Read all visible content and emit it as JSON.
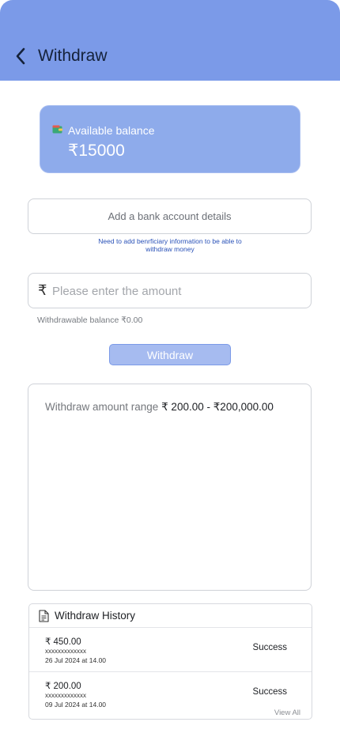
{
  "header": {
    "title": "Withdraw",
    "back_icon": "chevron-left-icon"
  },
  "balance": {
    "label": "Available balance",
    "value": "₹15000",
    "icon": "wallet-icon"
  },
  "bank": {
    "button_label": "Add a bank account details",
    "note": "Need to add benrficiary information to be able to withdraw money"
  },
  "amount": {
    "currency_symbol": "₹",
    "placeholder": "Please enter the amount",
    "value": "",
    "withdrawable_text": "Withdrawable balance ₹0.00"
  },
  "withdraw_button": {
    "label": "Withdraw"
  },
  "range": {
    "label": "Withdraw amount range",
    "value": "₹ 200.00 - ₹200,000.00"
  },
  "history": {
    "title": "Withdraw History",
    "icon": "document-icon",
    "items": [
      {
        "amount": "₹ 450.00",
        "account": "xxxxxxxxxxxxx",
        "date": "26 Jul 2024 at 14.00",
        "status": "Success"
      },
      {
        "amount": "₹ 200.00",
        "account": "xxxxxxxxxxxxx",
        "date": "09 Jul 2024 at 14.00",
        "status": "Success"
      }
    ],
    "view_all": "View All"
  },
  "colors": {
    "header_bg": "#7b9ae8",
    "card_bg": "#8eabeb",
    "button_bg": "#a6bbf0",
    "note_text": "#2a52b8"
  }
}
